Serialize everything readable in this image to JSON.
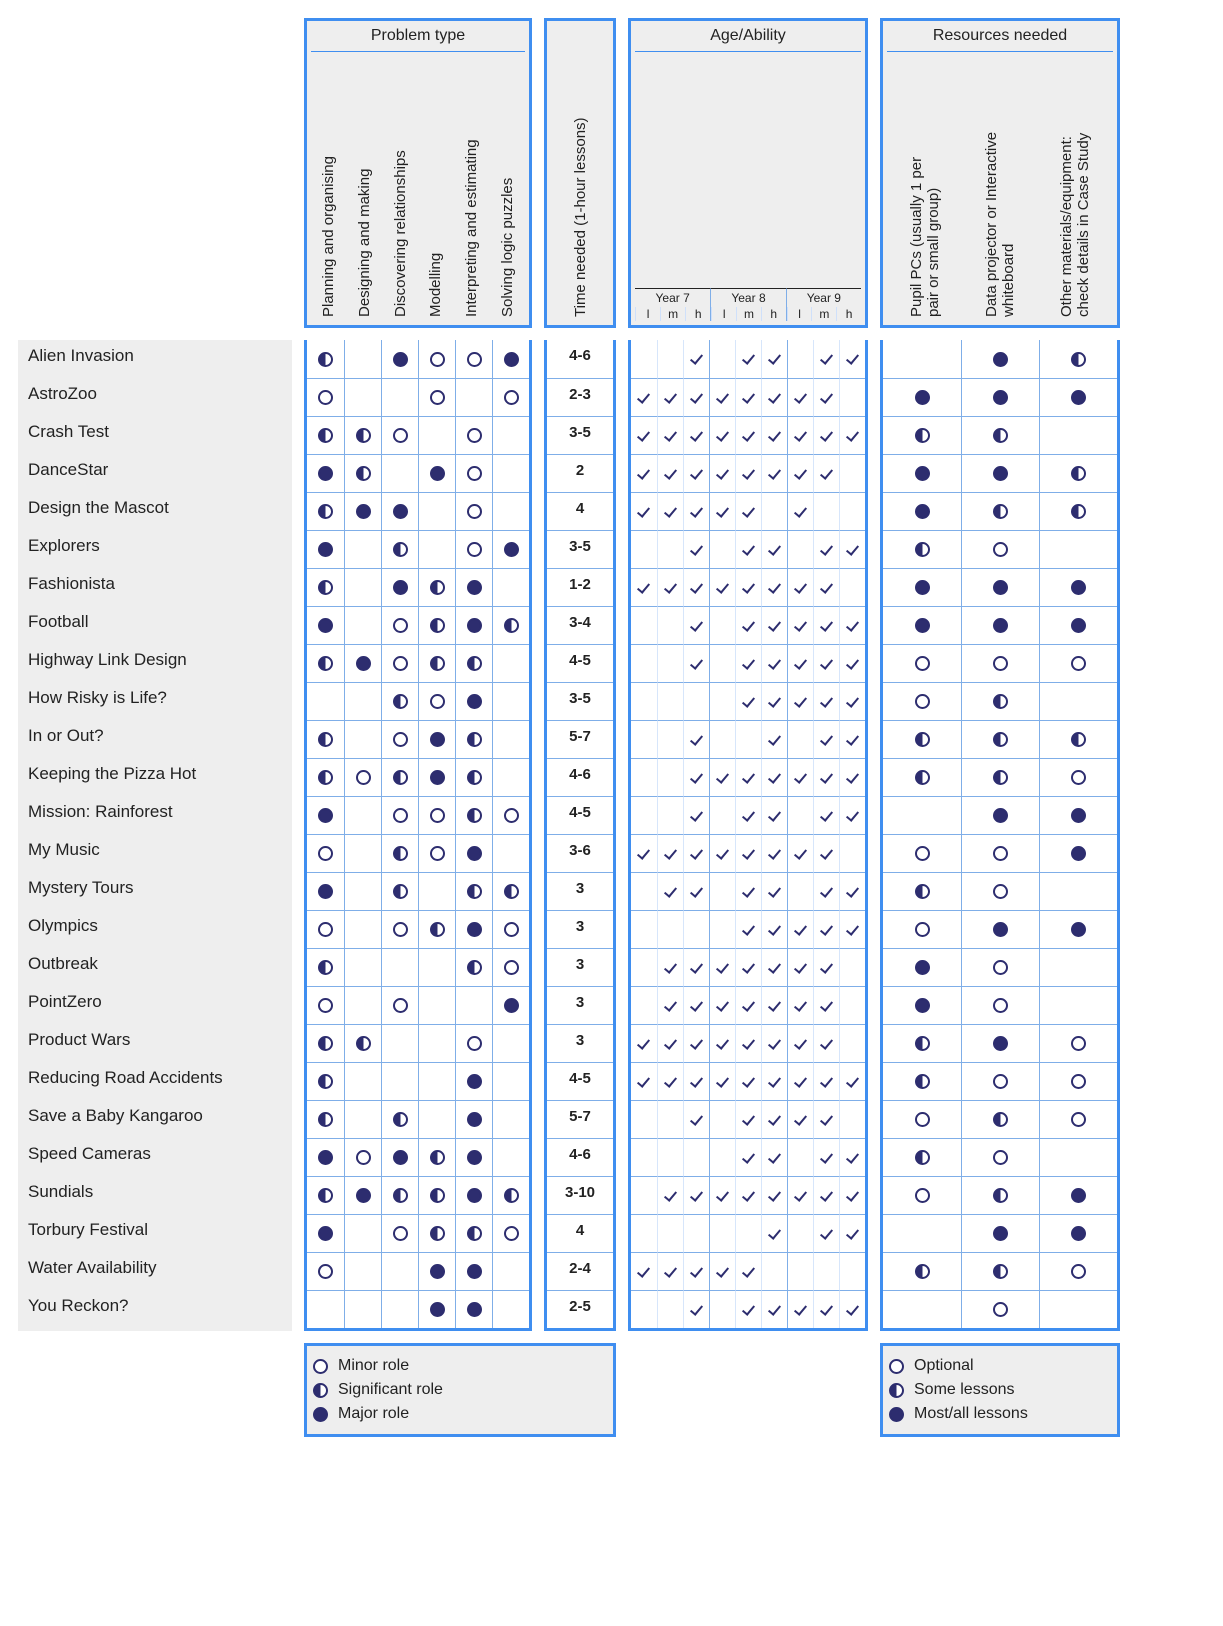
{
  "groups": {
    "problem_type": {
      "title": "Problem type",
      "cols": [
        "Planning and organising",
        "Designing and making",
        "Discovering relationships",
        "Modelling",
        "Interpreting and estimating",
        "Solving logic puzzles"
      ]
    },
    "time": {
      "title": "Time needed (1-hour lessons)"
    },
    "age": {
      "title": "Age/Ability",
      "years": [
        "Year 7",
        "Year 8",
        "Year 9"
      ],
      "levels": [
        "l",
        "m",
        "h"
      ]
    },
    "resources": {
      "title": "Resources needed",
      "cols": [
        "Pupil PCs (usually 1 per\npair or small group)",
        "Data projector or Interactive\nwhiteboard",
        "Other materials/equipment:\ncheck details in Case Study"
      ]
    }
  },
  "legend_role": {
    "minor": "Minor role",
    "significant": "Significant role",
    "major": "Major role"
  },
  "legend_res": {
    "optional": "Optional",
    "some": "Some lessons",
    "most": "Most/all lessons"
  },
  "rows": [
    {
      "name": "Alien Invasion",
      "pt": [
        "h",
        "",
        "f",
        "e",
        "e",
        "f"
      ],
      "time": "4-6",
      "age": [
        "",
        "",
        "t",
        "",
        "t",
        "t",
        "",
        "t",
        "t"
      ],
      "res": [
        "",
        "f",
        "h"
      ]
    },
    {
      "name": "AstroZoo",
      "pt": [
        "e",
        "",
        "",
        "e",
        "",
        "e"
      ],
      "time": "2-3",
      "age": [
        "t",
        "t",
        "t",
        "t",
        "t",
        "t",
        "t",
        "t",
        ""
      ],
      "res": [
        "f",
        "f",
        "f"
      ]
    },
    {
      "name": "Crash Test",
      "pt": [
        "h",
        "h",
        "e",
        "",
        "e",
        ""
      ],
      "time": "3-5",
      "age": [
        "t",
        "t",
        "t",
        "t",
        "t",
        "t",
        "t",
        "t",
        "t"
      ],
      "res": [
        "h",
        "h",
        ""
      ]
    },
    {
      "name": "DanceStar",
      "pt": [
        "f",
        "h",
        "",
        "f",
        "e",
        ""
      ],
      "time": "2",
      "age": [
        "t",
        "t",
        "t",
        "t",
        "t",
        "t",
        "t",
        "t",
        ""
      ],
      "res": [
        "f",
        "f",
        "h"
      ]
    },
    {
      "name": "Design the Mascot",
      "pt": [
        "h",
        "f",
        "f",
        "",
        "e",
        ""
      ],
      "time": "4",
      "age": [
        "t",
        "t",
        "t",
        "t",
        "t",
        "",
        "t",
        "",
        ""
      ],
      "res": [
        "f",
        "h",
        "h"
      ]
    },
    {
      "name": "Explorers",
      "pt": [
        "f",
        "",
        "h",
        "",
        "e",
        "f"
      ],
      "time": "3-5",
      "age": [
        "",
        "",
        "t",
        "",
        "t",
        "t",
        "",
        "t",
        "t"
      ],
      "res": [
        "h",
        "e",
        ""
      ]
    },
    {
      "name": "Fashionista",
      "pt": [
        "h",
        "",
        "f",
        "h",
        "f",
        ""
      ],
      "time": "1-2",
      "age": [
        "t",
        "t",
        "t",
        "t",
        "t",
        "t",
        "t",
        "t",
        ""
      ],
      "res": [
        "f",
        "f",
        "f"
      ]
    },
    {
      "name": "Football",
      "pt": [
        "f",
        "",
        "e",
        "h",
        "f",
        "h"
      ],
      "time": "3-4",
      "age": [
        "",
        "",
        "t",
        "",
        "t",
        "t",
        "t",
        "t",
        "t"
      ],
      "res": [
        "f",
        "f",
        "f"
      ]
    },
    {
      "name": "Highway Link Design",
      "pt": [
        "h",
        "f",
        "e",
        "h",
        "h",
        ""
      ],
      "time": "4-5",
      "age": [
        "",
        "",
        "t",
        "",
        "t",
        "t",
        "t",
        "t",
        "t"
      ],
      "res": [
        "e",
        "e",
        "e"
      ]
    },
    {
      "name": "How Risky is Life?",
      "pt": [
        "",
        "",
        "h",
        "e",
        "f",
        ""
      ],
      "time": "3-5",
      "age": [
        "",
        "",
        "",
        "",
        "t",
        "t",
        "t",
        "t",
        "t"
      ],
      "res": [
        "e",
        "h",
        ""
      ]
    },
    {
      "name": "In or Out?",
      "pt": [
        "h",
        "",
        "e",
        "f",
        "h",
        ""
      ],
      "time": "5-7",
      "age": [
        "",
        "",
        "t",
        "",
        "",
        "t",
        "",
        "t",
        "t"
      ],
      "res": [
        "h",
        "h",
        "h"
      ]
    },
    {
      "name": "Keeping the Pizza Hot",
      "pt": [
        "h",
        "e",
        "h",
        "f",
        "h",
        ""
      ],
      "time": "4-6",
      "age": [
        "",
        "",
        "t",
        "t",
        "t",
        "t",
        "t",
        "t",
        "t"
      ],
      "res": [
        "h",
        "h",
        "e"
      ]
    },
    {
      "name": "Mission: Rainforest",
      "pt": [
        "f",
        "",
        "e",
        "e",
        "h",
        "e"
      ],
      "time": "4-5",
      "age": [
        "",
        "",
        "t",
        "",
        "t",
        "t",
        "",
        "t",
        "t"
      ],
      "res": [
        "",
        "f",
        "f"
      ]
    },
    {
      "name": "My Music",
      "pt": [
        "e",
        "",
        "h",
        "e",
        "f",
        ""
      ],
      "time": "3-6",
      "age": [
        "t",
        "t",
        "t",
        "t",
        "t",
        "t",
        "t",
        "t",
        ""
      ],
      "res": [
        "e",
        "e",
        "f"
      ]
    },
    {
      "name": "Mystery Tours",
      "pt": [
        "f",
        "",
        "h",
        "",
        "h",
        "h"
      ],
      "time": "3",
      "age": [
        "",
        "t",
        "t",
        "",
        "t",
        "t",
        "",
        "t",
        "t"
      ],
      "res": [
        "h",
        "e",
        ""
      ]
    },
    {
      "name": "Olympics",
      "pt": [
        "e",
        "",
        "e",
        "h",
        "f",
        "e"
      ],
      "time": "3",
      "age": [
        "",
        "",
        "",
        "",
        "t",
        "t",
        "t",
        "t",
        "t"
      ],
      "res": [
        "e",
        "f",
        "f"
      ]
    },
    {
      "name": "Outbreak",
      "pt": [
        "h",
        "",
        "",
        "",
        "h",
        "e"
      ],
      "time": "3",
      "age": [
        "",
        "t",
        "t",
        "t",
        "t",
        "t",
        "t",
        "t",
        ""
      ],
      "res": [
        "f",
        "e",
        ""
      ]
    },
    {
      "name": "PointZero",
      "pt": [
        "e",
        "",
        "e",
        "",
        "",
        "f"
      ],
      "time": "3",
      "age": [
        "",
        "t",
        "t",
        "t",
        "t",
        "t",
        "t",
        "t",
        ""
      ],
      "res": [
        "f",
        "e",
        ""
      ]
    },
    {
      "name": "Product Wars",
      "pt": [
        "h",
        "h",
        "",
        "",
        "e",
        ""
      ],
      "time": "3",
      "age": [
        "t",
        "t",
        "t",
        "t",
        "t",
        "t",
        "t",
        "t",
        ""
      ],
      "res": [
        "h",
        "f",
        "e"
      ]
    },
    {
      "name": "Reducing Road Accidents",
      "pt": [
        "h",
        "",
        "",
        "",
        "f",
        ""
      ],
      "time": "4-5",
      "age": [
        "t",
        "t",
        "t",
        "t",
        "t",
        "t",
        "t",
        "t",
        "t"
      ],
      "res": [
        "h",
        "e",
        "e"
      ]
    },
    {
      "name": "Save a Baby Kangaroo",
      "pt": [
        "h",
        "",
        "h",
        "",
        "f",
        ""
      ],
      "time": "5-7",
      "age": [
        "",
        "",
        "t",
        "",
        "t",
        "t",
        "t",
        "t",
        ""
      ],
      "res": [
        "e",
        "h",
        "e"
      ]
    },
    {
      "name": "Speed Cameras",
      "pt": [
        "f",
        "e",
        "f",
        "h",
        "f",
        ""
      ],
      "time": "4-6",
      "age": [
        "",
        "",
        "",
        "",
        "t",
        "t",
        "",
        "t",
        "t"
      ],
      "res": [
        "h",
        "e",
        ""
      ]
    },
    {
      "name": "Sundials",
      "pt": [
        "h",
        "f",
        "h",
        "h",
        "f",
        "h"
      ],
      "time": "3-10",
      "age": [
        "",
        "t",
        "t",
        "t",
        "t",
        "t",
        "t",
        "t",
        "t"
      ],
      "res": [
        "e",
        "h",
        "f"
      ]
    },
    {
      "name": "Torbury Festival",
      "pt": [
        "f",
        "",
        "e",
        "h",
        "h",
        "e"
      ],
      "time": "4",
      "age": [
        "",
        "",
        "",
        "",
        "",
        "t",
        "",
        "t",
        "t"
      ],
      "res": [
        "",
        "f",
        "f"
      ]
    },
    {
      "name": "Water Availability",
      "pt": [
        "e",
        "",
        "",
        "f",
        "f",
        ""
      ],
      "time": "2-4",
      "age": [
        "t",
        "t",
        "t",
        "t",
        "t",
        "",
        "",
        "",
        ""
      ],
      "res": [
        "h",
        "h",
        "e"
      ]
    },
    {
      "name": "You Reckon?",
      "pt": [
        "",
        "",
        "",
        "f",
        "f",
        ""
      ],
      "time": "2-5",
      "age": [
        "",
        "",
        "t",
        "",
        "t",
        "t",
        "t",
        "t",
        "t"
      ],
      "res": [
        "",
        "e",
        ""
      ]
    }
  ],
  "chart_data": {
    "type": "table",
    "note": "Matrix of lesson resources; pt codes: e=minor, h=significant, f=major; res codes: e=optional, h=some lessons, f=most/all; age t=tick present across Year7 l/m/h, Year8 l/m/h, Year9 l/m/h."
  }
}
